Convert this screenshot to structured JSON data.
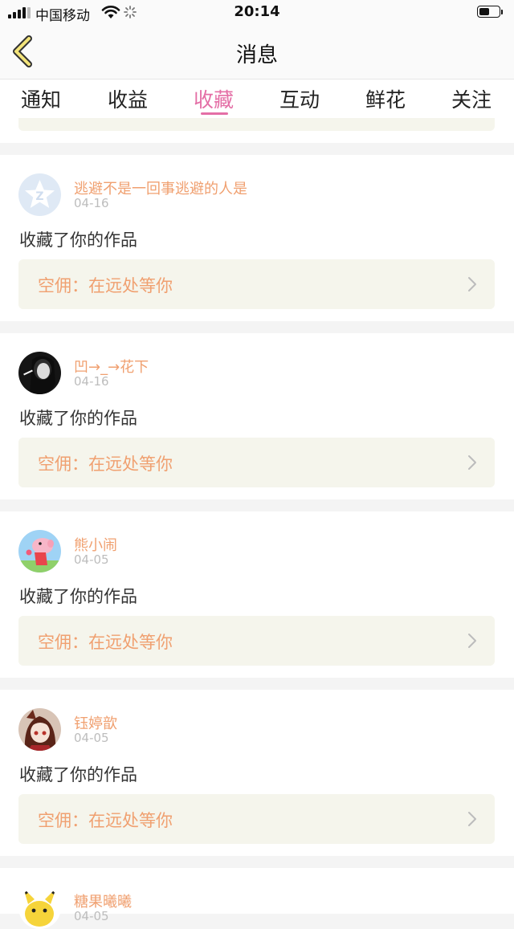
{
  "status_bar": {
    "carrier": "中国移动",
    "time": "20:14"
  },
  "nav": {
    "title": "消息"
  },
  "tabs": [
    {
      "label": "通知"
    },
    {
      "label": "收益"
    },
    {
      "label": "收藏"
    },
    {
      "label": "互动"
    },
    {
      "label": "鲜花"
    },
    {
      "label": "关注"
    }
  ],
  "active_tab": "收藏",
  "colors": {
    "accent": "#e46fa6",
    "name": "#f0a070",
    "work_box_bg": "#f5f5ec"
  },
  "messages": [
    {
      "user": "逃避不是一回事逃避的人是",
      "date": "04-16",
      "action": "收藏了你的作品",
      "work": "空佣：在远处等你",
      "avatar": "default-qq-avatar"
    },
    {
      "user": "凹→_→花下",
      "date": "04-16",
      "action": "收藏了你的作品",
      "work": "空佣：在远处等你",
      "avatar": "dark-portrait-avatar"
    },
    {
      "user": "熊小闹",
      "date": "04-05",
      "action": "收藏了你的作品",
      "work": "空佣：在远处等你",
      "avatar": "peppa-pig-avatar"
    },
    {
      "user": "钰婷歆",
      "date": "04-05",
      "action": "收藏了你的作品",
      "work": "空佣：在远处等你",
      "avatar": "anime-girl-avatar"
    },
    {
      "user": "糖果曦曦",
      "date": "04-05",
      "action": "",
      "work": "",
      "avatar": "pikachu-avatar"
    }
  ]
}
